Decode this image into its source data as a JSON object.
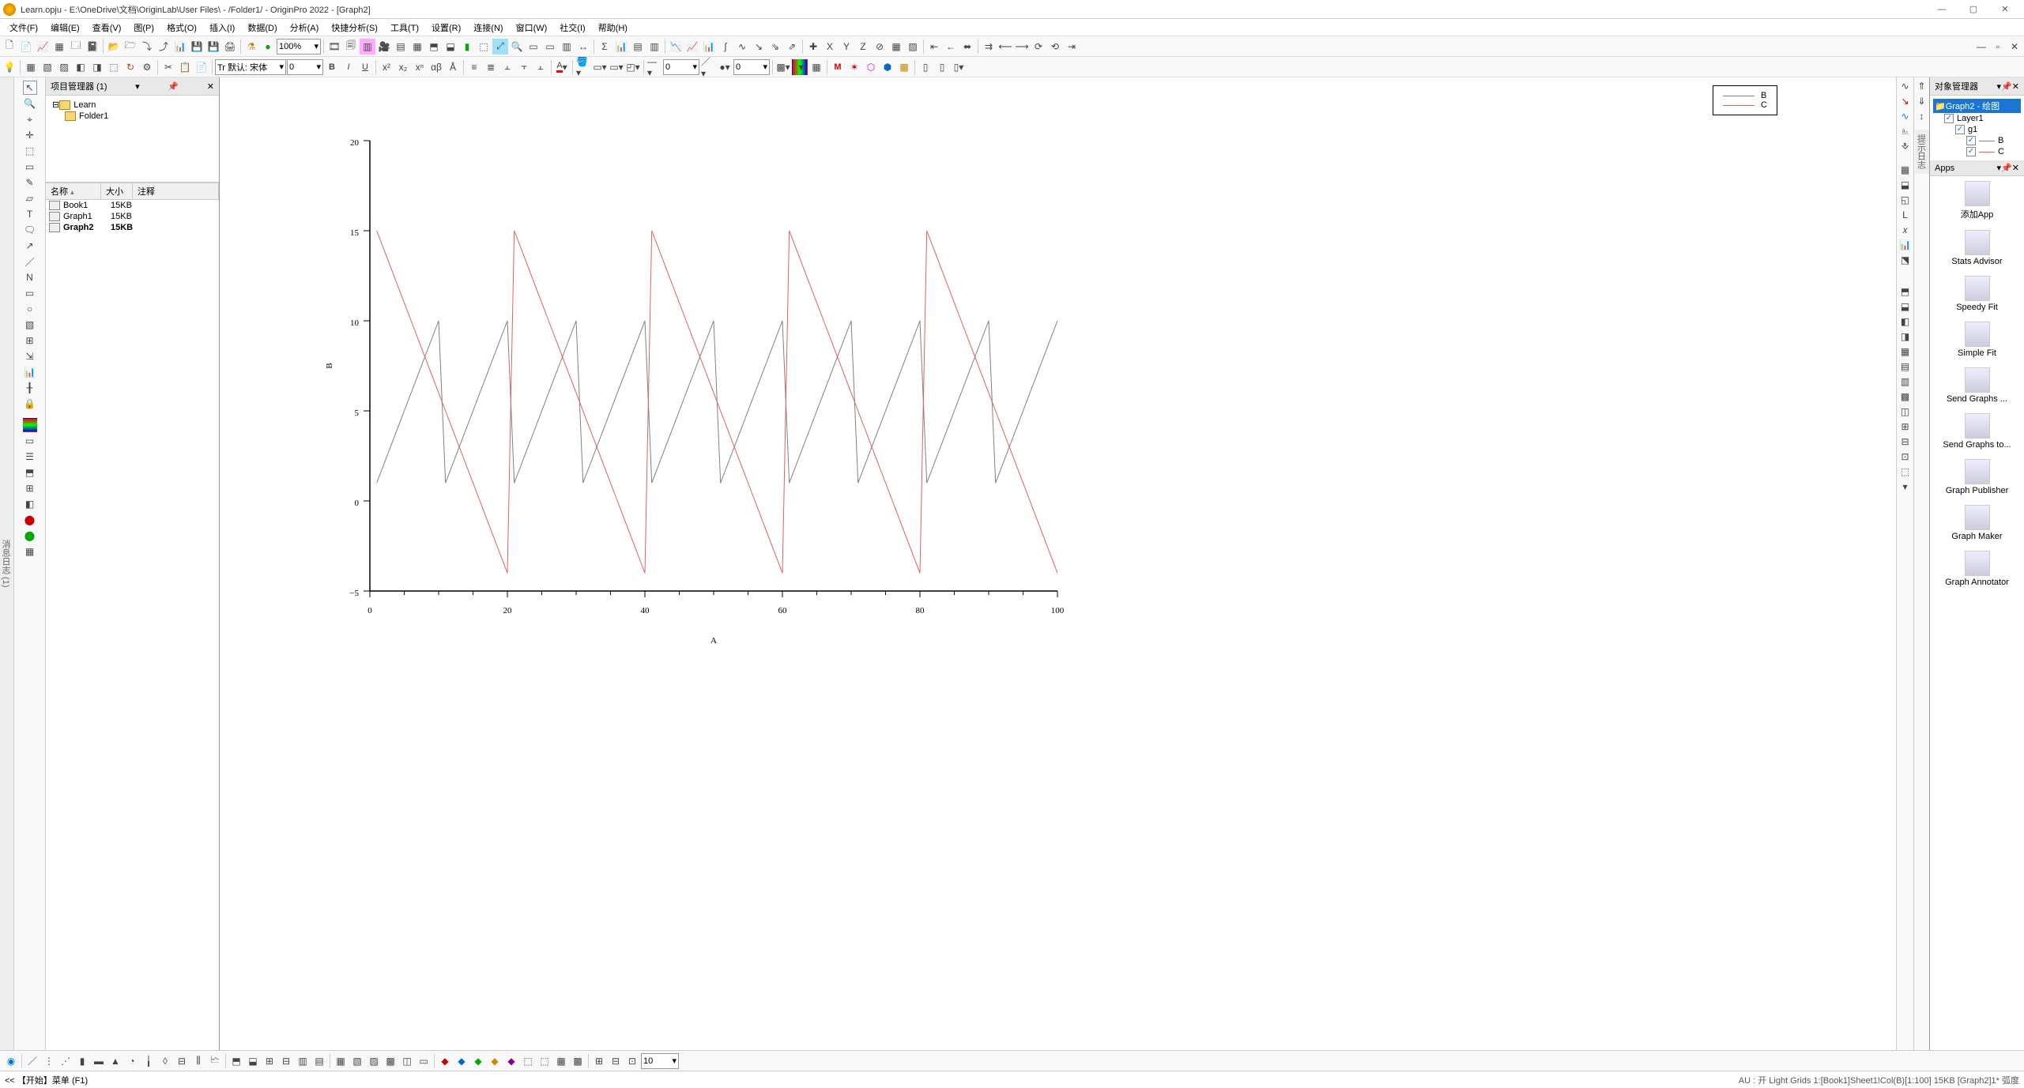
{
  "titlebar": {
    "title": "Learn.opju - E:\\OneDrive\\文档\\OriginLab\\User Files\\ - /Folder1/ - OriginPro 2022 - [Graph2]"
  },
  "menubar": {
    "items": [
      "文件(F)",
      "编辑(E)",
      "查看(V)",
      "图(P)",
      "格式(O)",
      "插入(I)",
      "数据(D)",
      "分析(A)",
      "快捷分析(S)",
      "工具(T)",
      "设置(R)",
      "连接(N)",
      "窗口(W)",
      "社交(I)",
      "帮助(H)"
    ]
  },
  "toolbar1": {
    "zoom": "100%"
  },
  "toolbar2": {
    "font_label": "Tr 默认: 宋体",
    "font_size": "0",
    "linewidth": "0"
  },
  "project_explorer": {
    "title": "项目管理器 (1)",
    "tree": [
      {
        "label": "Learn",
        "indent": 0
      },
      {
        "label": "Folder1",
        "indent": 1
      }
    ],
    "cols": {
      "name": "名称",
      "size": "大小",
      "note": "注释"
    },
    "items": [
      {
        "name": "Book1",
        "size": "15KB",
        "bold": false
      },
      {
        "name": "Graph1",
        "size": "15KB",
        "bold": false
      },
      {
        "name": "Graph2",
        "size": "15KB",
        "bold": true
      }
    ]
  },
  "left_tab": {
    "label": "消息日志 (1)"
  },
  "doc_tab": {
    "label": "1"
  },
  "object_manager": {
    "title": "对象管理器",
    "tree": {
      "root": "Graph2 - 绘图",
      "layer": "Layer1",
      "group": "g1",
      "plotB": "B",
      "plotC": "C"
    }
  },
  "apps_panel": {
    "title": "Apps",
    "items": [
      "添加App",
      "Stats Advisor",
      "Speedy Fit",
      "Simple Fit",
      "Send Graphs ...",
      "Send Graphs to...",
      "Graph Publisher",
      "Graph Maker",
      "Graph Annotator"
    ]
  },
  "statusbar": {
    "left": "  << 【开始】菜单 (F1)",
    "right": "AU : 开  Light Grids  1:[Book1]Sheet1!Col(B)[1:100]  15KB   [Graph2]1* 弧度"
  },
  "bottombar": {
    "label": "10"
  },
  "chart_data": {
    "type": "line",
    "title": "",
    "xlabel": "A",
    "ylabel": "B",
    "xlim": [
      0,
      100
    ],
    "ylim": [
      -5,
      20
    ],
    "xticks": [
      0,
      20,
      40,
      60,
      80,
      100
    ],
    "yticks": [
      -5,
      0,
      5,
      10,
      15,
      20
    ],
    "series": [
      {
        "name": "B",
        "color": "#808080",
        "x": [
          1,
          2,
          3,
          4,
          5,
          6,
          7,
          8,
          9,
          10,
          11,
          12,
          13,
          14,
          15,
          16,
          17,
          18,
          19,
          20,
          21,
          22,
          23,
          24,
          25,
          26,
          27,
          28,
          29,
          30,
          31,
          32,
          33,
          34,
          35,
          36,
          37,
          38,
          39,
          40,
          41,
          42,
          43,
          44,
          45,
          46,
          47,
          48,
          49,
          50,
          51,
          52,
          53,
          54,
          55,
          56,
          57,
          58,
          59,
          60,
          61,
          62,
          63,
          64,
          65,
          66,
          67,
          68,
          69,
          70,
          71,
          72,
          73,
          74,
          75,
          76,
          77,
          78,
          79,
          80,
          81,
          82,
          83,
          84,
          85,
          86,
          87,
          88,
          89,
          90,
          91,
          92,
          93,
          94,
          95,
          96,
          97,
          98,
          99,
          100
        ],
        "y": [
          1,
          2,
          3,
          4,
          5,
          6,
          7,
          8,
          9,
          10,
          1,
          2,
          3,
          4,
          5,
          6,
          7,
          8,
          9,
          10,
          1,
          2,
          3,
          4,
          5,
          6,
          7,
          8,
          9,
          10,
          1,
          2,
          3,
          4,
          5,
          6,
          7,
          8,
          9,
          10,
          1,
          2,
          3,
          4,
          5,
          6,
          7,
          8,
          9,
          10,
          1,
          2,
          3,
          4,
          5,
          6,
          7,
          8,
          9,
          10,
          1,
          2,
          3,
          4,
          5,
          6,
          7,
          8,
          9,
          10,
          1,
          2,
          3,
          4,
          5,
          6,
          7,
          8,
          9,
          10,
          1,
          2,
          3,
          4,
          5,
          6,
          7,
          8,
          9,
          10,
          1,
          2,
          3,
          4,
          5,
          6,
          7,
          8,
          9,
          10
        ]
      },
      {
        "name": "C",
        "color": "#e06060",
        "x": [
          1,
          2,
          3,
          4,
          5,
          6,
          7,
          8,
          9,
          10,
          11,
          12,
          13,
          14,
          15,
          16,
          17,
          18,
          19,
          20,
          21,
          22,
          23,
          24,
          25,
          26,
          27,
          28,
          29,
          30,
          31,
          32,
          33,
          34,
          35,
          36,
          37,
          38,
          39,
          40,
          41,
          42,
          43,
          44,
          45,
          46,
          47,
          48,
          49,
          50,
          51,
          52,
          53,
          54,
          55,
          56,
          57,
          58,
          59,
          60,
          61,
          62,
          63,
          64,
          65,
          66,
          67,
          68,
          69,
          70,
          71,
          72,
          73,
          74,
          75,
          76,
          77,
          78,
          79,
          80,
          81,
          82,
          83,
          84,
          85,
          86,
          87,
          88,
          89,
          90,
          91,
          92,
          93,
          94,
          95,
          96,
          97,
          98,
          99,
          100
        ],
        "y": [
          15,
          14,
          13,
          12,
          11,
          10,
          9,
          8,
          7,
          6,
          5,
          4,
          3,
          2,
          1,
          0,
          -1,
          -2,
          -3,
          -4,
          15,
          14,
          13,
          12,
          11,
          10,
          9,
          8,
          7,
          6,
          5,
          4,
          3,
          2,
          1,
          0,
          -1,
          -2,
          -3,
          -4,
          15,
          14,
          13,
          12,
          11,
          10,
          9,
          8,
          7,
          6,
          5,
          4,
          3,
          2,
          1,
          0,
          -1,
          -2,
          -3,
          -4,
          15,
          14,
          13,
          12,
          11,
          10,
          9,
          8,
          7,
          6,
          5,
          4,
          3,
          2,
          1,
          0,
          -1,
          -2,
          -3,
          -4,
          15,
          14,
          13,
          12,
          11,
          10,
          9,
          8,
          7,
          6,
          5,
          4,
          3,
          2,
          1,
          0,
          -1,
          -2,
          -3,
          -4
        ]
      }
    ],
    "legend": {
      "position": "top-right",
      "items": [
        "B",
        "C"
      ]
    }
  }
}
